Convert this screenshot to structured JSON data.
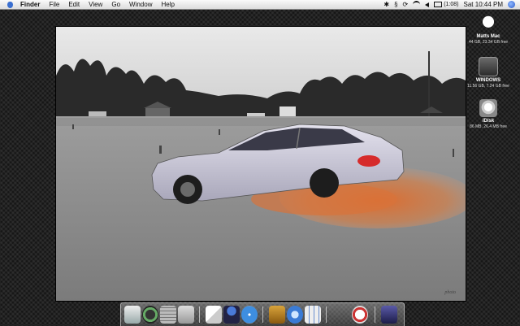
{
  "menubar": {
    "app": "Finder",
    "items": [
      "File",
      "Edit",
      "View",
      "Go",
      "Window",
      "Help"
    ],
    "battery": "(1:08)",
    "clock": "Sat 10:44 PM"
  },
  "desktop_icons": [
    {
      "name": "Matts Mac",
      "info": "44 GB, 23.34 GB free"
    },
    {
      "name": "WINDOWS",
      "info": "11.56 GB, 7.24 GB free"
    },
    {
      "name": "iDisk",
      "info": "86 MB, 26.4 MB free"
    }
  ],
  "photo": {
    "watermark": "photo",
    "subject": "car drifting in dirt"
  },
  "colors": {
    "dust": "#e06a2a",
    "car": "#c9c7d6",
    "menubar": "#e8e8e8"
  },
  "dock_items": [
    "finder-icon",
    "dashboard-icon",
    "calculator-icon",
    "preview-icon",
    "textedit-icon",
    "automator-icon",
    "safari-icon",
    "garageband-icon",
    "itunes-icon",
    "grid-icon",
    "photobooth-icon",
    "trash-icon"
  ]
}
